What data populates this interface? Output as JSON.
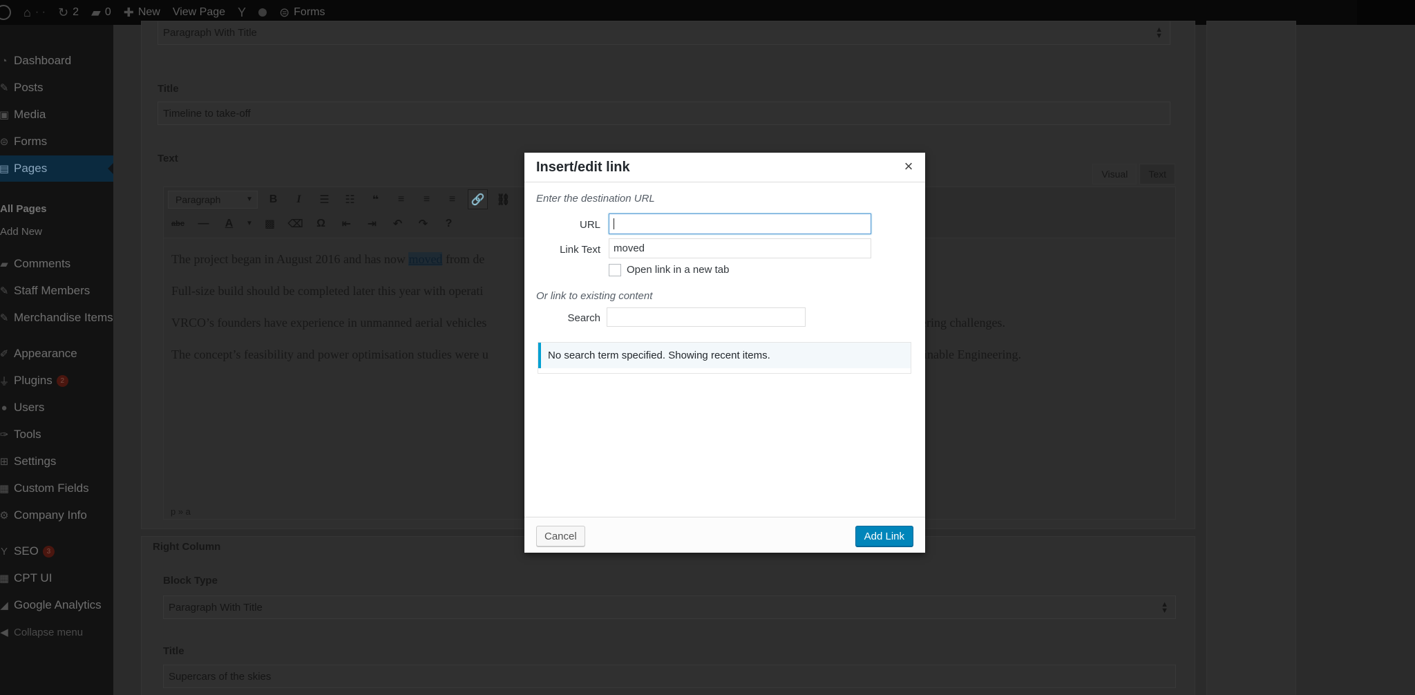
{
  "admin_bar": {
    "updates_count": "2",
    "comments_count": "0",
    "new_label": "New",
    "view_page_label": "View Page",
    "forms_label": "Forms"
  },
  "sidebar": {
    "items": [
      {
        "label": "Dashboard"
      },
      {
        "label": "Posts"
      },
      {
        "label": "Media"
      },
      {
        "label": "Forms"
      },
      {
        "label": "Pages"
      },
      {
        "label": "Comments"
      },
      {
        "label": "Staff Members"
      },
      {
        "label": "Merchandise Items"
      },
      {
        "label": "Appearance"
      },
      {
        "label": "Plugins",
        "badge": "2"
      },
      {
        "label": "Users"
      },
      {
        "label": "Tools"
      },
      {
        "label": "Settings"
      },
      {
        "label": "Custom Fields"
      },
      {
        "label": "Company Info"
      },
      {
        "label": "SEO",
        "badge": "3"
      },
      {
        "label": "CPT UI"
      },
      {
        "label": "Google Analytics"
      },
      {
        "label": "Collapse menu"
      }
    ],
    "submenu": {
      "all_pages": "All Pages",
      "add_new": "Add New"
    }
  },
  "left_column": {
    "block_type_value": "Paragraph With Title",
    "title_label": "Title",
    "title_value": "Timeline to take-off",
    "text_label": "Text",
    "editor": {
      "tab_visual": "Visual",
      "tab_text": "Text",
      "format_select": "Paragraph",
      "paragraphs": {
        "p1_before": "The project began in August 2016 and has now ",
        "p1_link": "moved",
        "p1_after": " from de",
        "p2": "Full-size build should be completed later this year with operati",
        "p3a": "VRCO’s founders have experience in unmanned aerial vehicles",
        "p3b": "eering challenges.",
        "p4a": "The concept’s feasibility and power optimisation studies were u",
        "p4b": "ainable Engineering."
      },
      "status_path": "p » a"
    }
  },
  "right_column": {
    "heading": "Right Column",
    "block_type_label": "Block Type",
    "block_type_value": "Paragraph With Title",
    "title_label": "Title",
    "title_value": "Supercars of the skies"
  },
  "modal": {
    "title": "Insert/edit link",
    "close_glyph": "×",
    "dest_note": "Enter the destination URL",
    "url_label": "URL",
    "url_value": "",
    "link_text_label": "Link Text",
    "link_text_value": "moved",
    "new_tab_label": "Open link in a new tab",
    "existing_note": "Or link to existing content",
    "search_label": "Search",
    "search_value": "",
    "results_notice": "No search term specified. Showing recent items.",
    "cancel_label": "Cancel",
    "add_label": "Add Link"
  }
}
